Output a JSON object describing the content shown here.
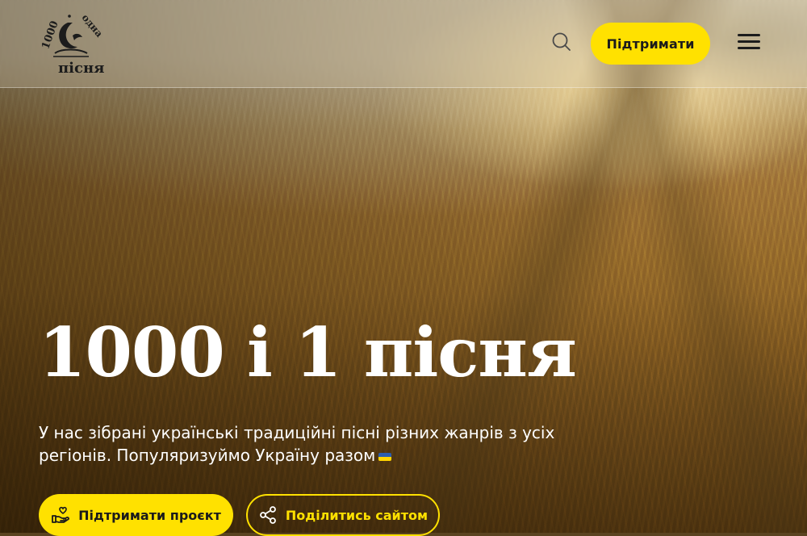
{
  "header": {
    "logo_alt": "1000 і одна пісня",
    "search_icon": "search-icon",
    "support_label": "Підтримати",
    "menu_icon": "hamburger-menu-icon"
  },
  "hero": {
    "title": "1000 і 1 пісня",
    "subtitle": "У нас зібрані українські традиційні пісні різних жанрів з усіх регіонів. Популяризуймо Україну разом",
    "flag_icon": "ukraine-flag-icon",
    "primary_cta": "Підтримати проєкт",
    "primary_cta_icon": "hand-heart-icon",
    "secondary_cta": "Поділитись сайтом",
    "secondary_cta_icon": "share-icon"
  },
  "colors": {
    "accent": "#ffe100",
    "text_light": "#ffffff",
    "text_dark": "#1b1b1b"
  }
}
